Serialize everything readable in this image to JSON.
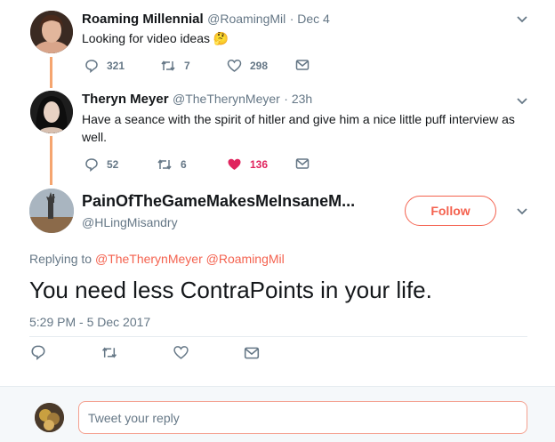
{
  "tweet1": {
    "name": "Roaming Millennial",
    "handle": "@RoamingMil",
    "time": "· Dec 4",
    "text": "Looking for video ideas",
    "emoji": "🤔",
    "replies": "321",
    "retweets": "7",
    "likes": "298"
  },
  "tweet2": {
    "name": "Theryn Meyer",
    "handle": "@TheTherynMeyer",
    "time": "· 23h",
    "text_line1": "Have a seance with the spirit of hitler and give him a nice little puff interview as",
    "text_line2": "well.",
    "replies": "52",
    "retweets": "6",
    "likes": "136"
  },
  "main_tweet": {
    "name": "PainOfTheGameMakesMeInsaneM...",
    "handle": "@HLingMisandry",
    "follow_label": "Follow",
    "replying_prefix": "Replying to",
    "reply_to_1": "@TheTherynMeyer",
    "reply_to_2": "@RoamingMil",
    "text": "You need less ContraPoints in your life.",
    "timestamp": "5:29 PM - 5 Dec 2017"
  },
  "reply": {
    "placeholder": "Tweet your reply"
  },
  "colors": {
    "accent": "#f4624f",
    "like_active": "#e0245e",
    "thread_line": "#f5a56f"
  }
}
